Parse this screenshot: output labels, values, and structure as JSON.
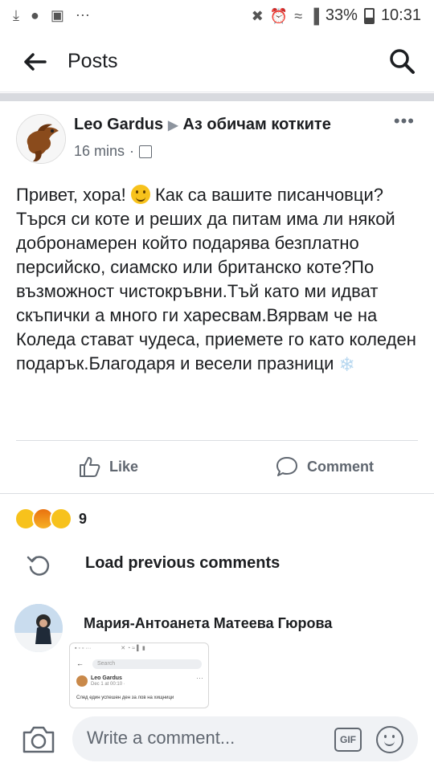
{
  "status_bar": {
    "battery": "33%",
    "time": "10:31",
    "icons": [
      "download-icon",
      "messenger-icon",
      "image-icon",
      "mute-icon",
      "alarm-icon",
      "wifi-icon",
      "signal-icon"
    ]
  },
  "header": {
    "title": "Posts"
  },
  "post": {
    "author": "Leo Gardus",
    "group": "Аз обичам котките",
    "time": "16 mins",
    "text_part1": "Привет, хора!",
    "text_part2": "Как са вашите писанчовци?",
    "text_part3": "Търся си коте и реших да питам има ли някой добронамерен който подарява безплатно персийско, сиамско или британско коте?По възможност чистокръвни.Тъй като ми идват скъпички а много ги харесвам.Вярвам че на Коледа стават чудеса, приемете го като коледен подарък.Благодаря и весели празници",
    "like_label": "Like",
    "comment_label": "Comment",
    "reaction_count": "9"
  },
  "comments": {
    "load_previous": "Load previous comments",
    "commenter_name": "Мария-Антоанета Матеева Гюрова",
    "thumbnail": {
      "search": "Search",
      "name": "Leo Gardus",
      "date": "Dec 1 at 00:10 ·",
      "line": "След един успешен ден за лов на хищници"
    }
  },
  "composer": {
    "placeholder": "Write a comment...",
    "gif_label": "GIF"
  },
  "colors": {
    "text": "#1c1e21",
    "secondary": "#606770",
    "divider": "#dadde1",
    "input_bg": "#f0f2f5"
  }
}
